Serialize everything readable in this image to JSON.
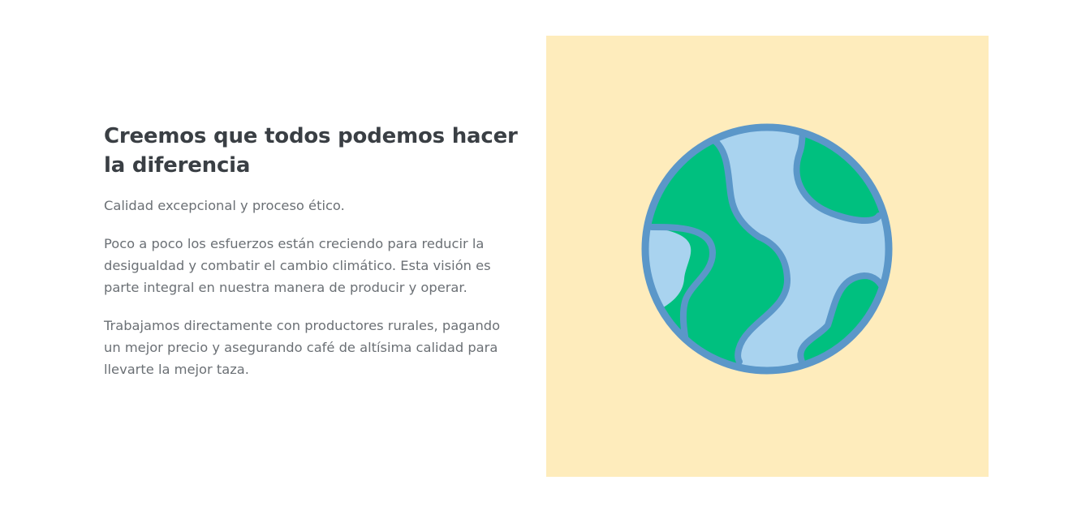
{
  "mission": {
    "title": "Creemos que todos podemos hacer la diferencia",
    "paragraphs": [
      "Calidad excepcional y proceso ético.",
      "Poco a poco los esfuerzos están creciendo para reducir la desigualdad y combatir el cambio climático. Esta visión es parte integral en nuestra manera de producir y operar.",
      "Trabajamos directamente con productores rurales, pagando un mejor precio y asegurando café de altísima calidad para llevarte la mejor taza."
    ]
  },
  "illustration": {
    "icon": "globe-icon",
    "colors": {
      "background": "#feecbc",
      "ocean": "#a9d3ef",
      "land": "#00c07f",
      "outline": "#5b97c9"
    }
  }
}
